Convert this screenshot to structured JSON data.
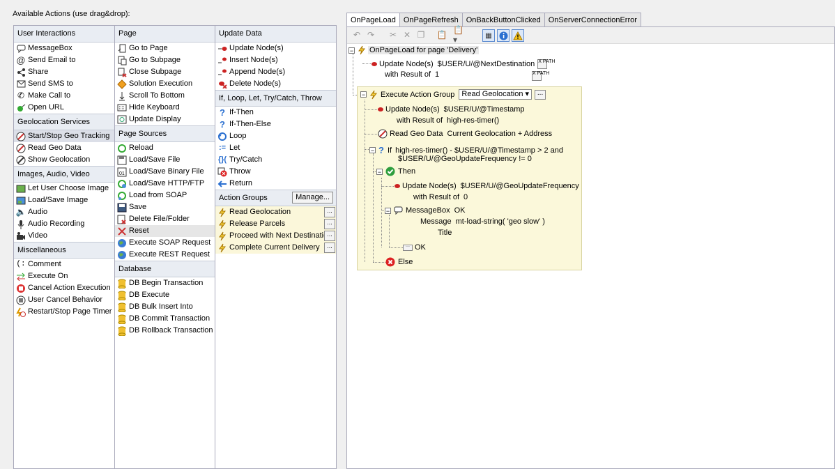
{
  "panel_title": "Available Actions (use drag&drop):",
  "col1": {
    "header": "User Interactions",
    "user_interactions": [
      "MessageBox",
      "Send Email to",
      "Share",
      "Send SMS to",
      "Make Call to",
      "Open URL"
    ],
    "geo_header": "Geolocation Services",
    "geo": [
      "Start/Stop Geo Tracking",
      "Read Geo Data",
      "Show Geolocation"
    ],
    "media_header": "Images, Audio, Video",
    "media": [
      "Let User Choose Image",
      "Load/Save Image",
      "Audio",
      "Audio Recording",
      "Video"
    ],
    "misc_header": "Miscellaneous",
    "misc": [
      "Comment",
      "Execute On",
      "Cancel Action Execution",
      "User Cancel Behavior",
      "Restart/Stop Page Timer"
    ]
  },
  "col2": {
    "header": "Page",
    "page": [
      "Go to Page",
      "Go to Subpage",
      "Close Subpage",
      "Solution Execution",
      "Scroll To Bottom",
      "Hide Keyboard",
      "Update Display"
    ],
    "sources_header": "Page Sources",
    "sources": [
      "Reload",
      "Load/Save File",
      "Load/Save Binary File",
      "Load/Save HTTP/FTP",
      "Load from SOAP",
      "Save",
      "Delete File/Folder",
      "Reset",
      "Execute SOAP Request",
      "Execute REST Request"
    ],
    "db_header": "Database",
    "db": [
      "DB Begin Transaction",
      "DB Execute",
      "DB Bulk Insert Into",
      "DB Commit Transaction",
      "DB Rollback Transaction"
    ]
  },
  "col3": {
    "header": "Update Data",
    "update": [
      "Update Node(s)",
      "Insert Node(s)",
      "Append Node(s)",
      "Delete Node(s)"
    ],
    "flow_header": "If, Loop, Let, Try/Catch, Throw",
    "flow": [
      "If-Then",
      "If-Then-Else",
      "Loop",
      "Let",
      "Try/Catch",
      "Throw",
      "Return"
    ],
    "ag_header": "Action Groups",
    "manage_label": "Manage...",
    "action_groups": [
      "Read Geolocation",
      "Release Parcels",
      "Proceed with Next Destinatio",
      "Complete Current Delivery"
    ],
    "dots_label": "..."
  },
  "tabs": [
    "OnPageLoad",
    "OnPageRefresh",
    "OnBackButtonClicked",
    "OnServerConnectionError"
  ],
  "tree": {
    "root": "OnPageLoad for page 'Delivery'",
    "update1_label": "Update Node(s)",
    "update1_target": "$USER/U/@NextDestination",
    "update1_result_label": "with Result of",
    "update1_result": "1",
    "xpath_label": "X PATH",
    "exec_label": "Execute Action Group",
    "exec_group": "Read Geolocation",
    "exec_dots": "...",
    "update2_label": "Update Node(s)",
    "update2_target": "$USER/U/@Timestamp",
    "update2_result_label": "with Result of",
    "update2_result": "high-res-timer()",
    "readgeo_label": "Read Geo Data",
    "readgeo_value": "Current Geolocation + Address",
    "if_label": "If",
    "if_cond1": "high-res-timer() - $USER/U/@Timestamp > 2 and",
    "if_cond2": "$USER/U/@GeoUpdateFrequency != 0",
    "then_label": "Then",
    "update3_label": "Update Node(s)",
    "update3_target": "$USER/U/@GeoUpdateFrequency",
    "update3_result_label": "with Result of",
    "update3_result": "0",
    "msgbox_label": "MessageBox",
    "msgbox_value": "OK",
    "message_label": "Message",
    "message_value": "mt-load-string( 'geo slow' )",
    "title_label": "Title",
    "ok_label": "OK",
    "else_label": "Else"
  }
}
